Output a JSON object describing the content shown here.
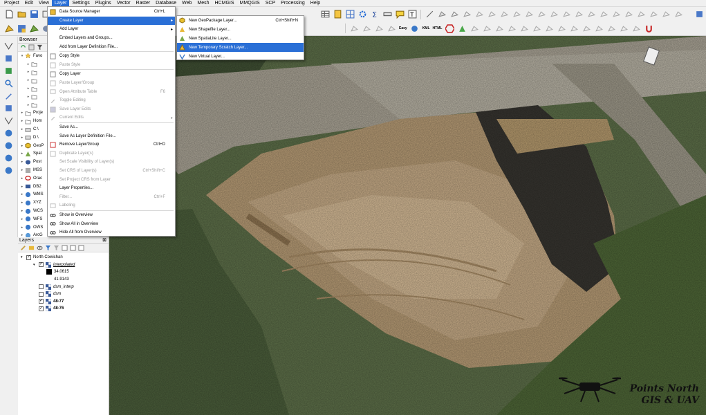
{
  "menubar": {
    "items": [
      "Project",
      "Edit",
      "View",
      "Layer",
      "Settings",
      "Plugins",
      "Vector",
      "Raster",
      "Database",
      "Web",
      "Mesh",
      "HCMGIS",
      "MMQGIS",
      "SCP",
      "Processing",
      "Help"
    ],
    "active_index": 3
  },
  "layer_menu": {
    "items": [
      {
        "label": "Data Source Manager",
        "shortcut": "Ctrl+L",
        "icon": "data-source-icon",
        "enabled": true
      },
      {
        "label": "Create Layer",
        "shortcut": "",
        "icon": "",
        "enabled": true,
        "submenu": true,
        "highlighted": true
      },
      {
        "label": "Add Layer",
        "shortcut": "",
        "icon": "",
        "enabled": true,
        "submenu": true
      },
      {
        "label": "Embed Layers and Groups...",
        "shortcut": "",
        "icon": "",
        "enabled": true
      },
      {
        "label": "Add from Layer Definition File...",
        "shortcut": "",
        "icon": "",
        "enabled": true
      },
      {
        "separator": true
      },
      {
        "label": "Copy Style",
        "shortcut": "",
        "icon": "copy-style-icon",
        "enabled": true
      },
      {
        "label": "Paste Style",
        "shortcut": "",
        "icon": "paste-style-icon",
        "enabled": false
      },
      {
        "separator": true
      },
      {
        "label": "Copy Layer",
        "shortcut": "",
        "icon": "copy-layer-icon",
        "enabled": true
      },
      {
        "label": "Paste Layer/Group",
        "shortcut": "",
        "icon": "paste-layer-icon",
        "enabled": false
      },
      {
        "label": "Open Attribute Table",
        "shortcut": "F6",
        "icon": "attribute-table-icon",
        "enabled": false
      },
      {
        "label": "Toggle Editing",
        "shortcut": "",
        "icon": "pencil-icon",
        "enabled": false
      },
      {
        "label": "Save Layer Edits",
        "shortcut": "",
        "icon": "save-edits-icon",
        "enabled": false
      },
      {
        "label": "Current Edits",
        "shortcut": "",
        "icon": "current-edits-icon",
        "enabled": false,
        "submenu": true
      },
      {
        "separator": true
      },
      {
        "label": "Save As...",
        "shortcut": "",
        "icon": "",
        "enabled": true
      },
      {
        "label": "Save As Layer Definition File...",
        "shortcut": "",
        "icon": "",
        "enabled": true
      },
      {
        "label": "Remove Layer/Group",
        "shortcut": "Ctrl+D",
        "icon": "remove-layer-icon",
        "enabled": true
      },
      {
        "label": "Duplicate Layer(s)",
        "shortcut": "",
        "icon": "duplicate-icon",
        "enabled": false
      },
      {
        "label": "Set Scale Visibility of Layer(s)",
        "shortcut": "",
        "icon": "",
        "enabled": false
      },
      {
        "label": "Set CRS of Layer(s)",
        "shortcut": "Ctrl+Shift+C",
        "icon": "",
        "enabled": false
      },
      {
        "label": "Set Project CRS from Layer",
        "shortcut": "",
        "icon": "",
        "enabled": false
      },
      {
        "label": "Layer Properties...",
        "shortcut": "",
        "icon": "",
        "enabled": true
      },
      {
        "label": "Filter...",
        "shortcut": "Ctrl+F",
        "icon": "",
        "enabled": false
      },
      {
        "label": "Labeling",
        "shortcut": "",
        "icon": "labeling-icon",
        "enabled": false
      },
      {
        "separator": true
      },
      {
        "label": "Show in Overview",
        "shortcut": "",
        "icon": "overview-icon",
        "enabled": true
      },
      {
        "label": "Show All in Overview",
        "shortcut": "",
        "icon": "overview-icon",
        "enabled": true
      },
      {
        "label": "Hide All from Overview",
        "shortcut": "",
        "icon": "overview-icon",
        "enabled": true
      }
    ]
  },
  "create_layer_submenu": {
    "items": [
      {
        "label": "New GeoPackage Layer...",
        "shortcut": "Ctrl+Shift+N",
        "icon": "geopackage-icon"
      },
      {
        "label": "New Shapefile Layer...",
        "shortcut": "",
        "icon": "shapefile-icon"
      },
      {
        "label": "New SpatiaLite Layer...",
        "shortcut": "",
        "icon": "spatialite-icon"
      },
      {
        "label": "New Temporary Scratch Layer...",
        "shortcut": "",
        "icon": "scratch-layer-icon",
        "highlighted": true
      },
      {
        "label": "New Virtual Layer...",
        "shortcut": "",
        "icon": "virtual-layer-icon"
      }
    ]
  },
  "browser": {
    "title": "Browser",
    "items": [
      {
        "label": "Favo",
        "depth": 0,
        "expanded": true,
        "icon": "star-icon"
      },
      {
        "label": "",
        "depth": 1,
        "icon": "folder-icon"
      },
      {
        "label": "",
        "depth": 1,
        "icon": "folder-icon"
      },
      {
        "label": "",
        "depth": 1,
        "icon": "folder-icon"
      },
      {
        "label": "",
        "depth": 1,
        "icon": "folder-icon"
      },
      {
        "label": "",
        "depth": 1,
        "icon": "folder-icon"
      },
      {
        "label": "",
        "depth": 1,
        "icon": "folder-icon"
      },
      {
        "label": "Proje",
        "depth": 0,
        "icon": "folder-icon"
      },
      {
        "label": "Hom",
        "depth": 0,
        "icon": "folder-icon"
      },
      {
        "label": "C:\\",
        "depth": 0,
        "icon": "drive-icon"
      },
      {
        "label": "D:\\",
        "depth": 0,
        "icon": "drive-icon"
      },
      {
        "label": "GeoP",
        "depth": 0,
        "icon": "geopackage-icon"
      },
      {
        "label": "Spat",
        "depth": 0,
        "icon": "spatialite-icon"
      },
      {
        "label": "Post",
        "depth": 0,
        "icon": "postgis-icon"
      },
      {
        "label": "MSS",
        "depth": 0,
        "icon": "mssql-icon"
      },
      {
        "label": "Orac",
        "depth": 0,
        "icon": "oracle-icon"
      },
      {
        "label": "DB2",
        "depth": 0,
        "icon": "db2-icon"
      },
      {
        "label": "WMS",
        "depth": 0,
        "icon": "wms-icon"
      },
      {
        "label": "XYZ",
        "depth": 0,
        "icon": "xyz-icon"
      },
      {
        "label": "WCS",
        "depth": 0,
        "icon": "wcs-icon"
      },
      {
        "label": "WFS",
        "depth": 0,
        "icon": "wfs-icon"
      },
      {
        "label": "OWS",
        "depth": 0,
        "icon": "ows-icon"
      },
      {
        "label": "ArcG",
        "depth": 0,
        "icon": "arcgis-icon"
      },
      {
        "label": "ArcG",
        "depth": 0,
        "icon": "arcgis-icon"
      }
    ]
  },
  "layers": {
    "title": "Layers",
    "items": [
      {
        "label": "North Cowichan",
        "type": "group",
        "checked": true,
        "style": "normal"
      },
      {
        "label": "interpolated",
        "type": "raster",
        "checked": true,
        "style": "italic-underline"
      },
      {
        "label": "34.0615",
        "type": "legend",
        "swatch": "#000000"
      },
      {
        "label": "41.9143",
        "type": "legend-label"
      },
      {
        "label": "dsm_interp",
        "type": "raster",
        "checked": false,
        "style": "italic"
      },
      {
        "label": "dsm",
        "type": "raster",
        "checked": false,
        "style": "italic"
      },
      {
        "label": "48-77",
        "type": "raster",
        "checked": true,
        "style": "bold"
      },
      {
        "label": "48-76",
        "type": "raster",
        "checked": true,
        "style": "bold"
      }
    ]
  },
  "toolbar": {
    "epsg_label": "Easy",
    "kml_label": "KML",
    "html_label": "HTML"
  },
  "watermark": {
    "line1": "Points North",
    "line2": "GIS & UAV"
  },
  "colors": {
    "accent": "#2a6fd6",
    "menu_bg": "#ffffff",
    "disabled": "#9a9a9a"
  }
}
